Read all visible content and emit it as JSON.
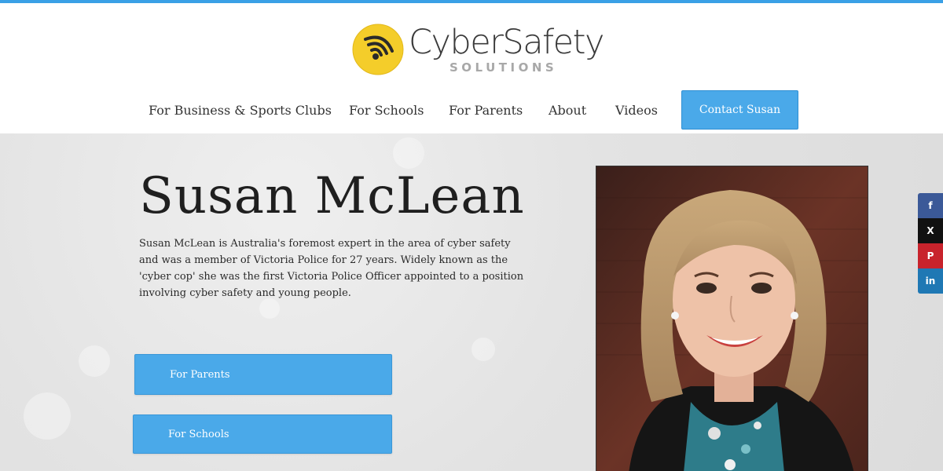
{
  "brand": {
    "name": "CyberSafety",
    "tagline": "SOLUTIONS"
  },
  "nav": {
    "items": [
      {
        "label": "For Business & Sports Clubs"
      },
      {
        "label": "For Schools"
      },
      {
        "label": "For Parents"
      },
      {
        "label": "About"
      },
      {
        "label": "Videos"
      }
    ],
    "contact_label": "Contact Susan"
  },
  "hero": {
    "title": "Susan McLean",
    "description": "Susan McLean is Australia's foremost expert in the area of cyber safety and was a member of Victoria Police for 27 years. Widely known as the 'cyber cop' she was the first Victoria Police Officer appointed to a position involving cyber safety and young people.",
    "buttons": [
      {
        "label": "For Parents"
      },
      {
        "label": "For Schools"
      }
    ]
  },
  "share": {
    "items": [
      {
        "icon": "facebook-icon",
        "glyph": "f"
      },
      {
        "icon": "x-icon",
        "glyph": "X"
      },
      {
        "icon": "pinterest-icon",
        "glyph": "P"
      },
      {
        "icon": "linkedin-icon",
        "glyph": "in"
      }
    ]
  },
  "colors": {
    "accent": "#4aa9e9",
    "logo_yellow": "#f4cd2a",
    "facebook": "#3b5998",
    "x": "#111111",
    "pinterest": "#c8232c",
    "linkedin": "#1f78b4"
  }
}
